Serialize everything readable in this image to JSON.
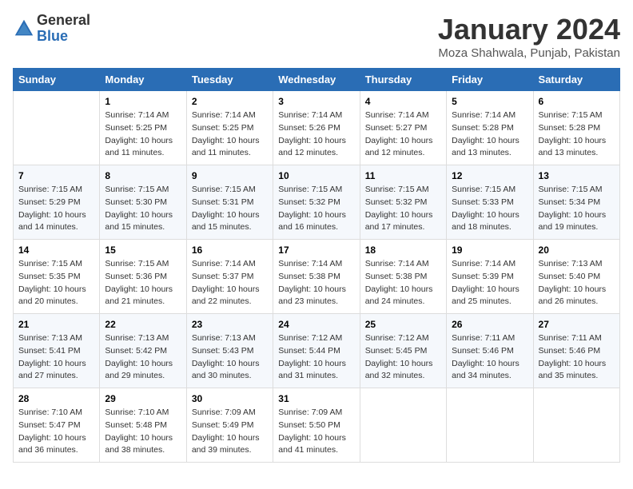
{
  "header": {
    "logo_general": "General",
    "logo_blue": "Blue",
    "month_title": "January 2024",
    "location": "Moza Shahwala, Punjab, Pakistan"
  },
  "days_of_week": [
    "Sunday",
    "Monday",
    "Tuesday",
    "Wednesday",
    "Thursday",
    "Friday",
    "Saturday"
  ],
  "weeks": [
    [
      {
        "day": "",
        "info": ""
      },
      {
        "day": "1",
        "info": "Sunrise: 7:14 AM\nSunset: 5:25 PM\nDaylight: 10 hours\nand 11 minutes."
      },
      {
        "day": "2",
        "info": "Sunrise: 7:14 AM\nSunset: 5:25 PM\nDaylight: 10 hours\nand 11 minutes."
      },
      {
        "day": "3",
        "info": "Sunrise: 7:14 AM\nSunset: 5:26 PM\nDaylight: 10 hours\nand 12 minutes."
      },
      {
        "day": "4",
        "info": "Sunrise: 7:14 AM\nSunset: 5:27 PM\nDaylight: 10 hours\nand 12 minutes."
      },
      {
        "day": "5",
        "info": "Sunrise: 7:14 AM\nSunset: 5:28 PM\nDaylight: 10 hours\nand 13 minutes."
      },
      {
        "day": "6",
        "info": "Sunrise: 7:15 AM\nSunset: 5:28 PM\nDaylight: 10 hours\nand 13 minutes."
      }
    ],
    [
      {
        "day": "7",
        "info": "Sunrise: 7:15 AM\nSunset: 5:29 PM\nDaylight: 10 hours\nand 14 minutes."
      },
      {
        "day": "8",
        "info": "Sunrise: 7:15 AM\nSunset: 5:30 PM\nDaylight: 10 hours\nand 15 minutes."
      },
      {
        "day": "9",
        "info": "Sunrise: 7:15 AM\nSunset: 5:31 PM\nDaylight: 10 hours\nand 15 minutes."
      },
      {
        "day": "10",
        "info": "Sunrise: 7:15 AM\nSunset: 5:32 PM\nDaylight: 10 hours\nand 16 minutes."
      },
      {
        "day": "11",
        "info": "Sunrise: 7:15 AM\nSunset: 5:32 PM\nDaylight: 10 hours\nand 17 minutes."
      },
      {
        "day": "12",
        "info": "Sunrise: 7:15 AM\nSunset: 5:33 PM\nDaylight: 10 hours\nand 18 minutes."
      },
      {
        "day": "13",
        "info": "Sunrise: 7:15 AM\nSunset: 5:34 PM\nDaylight: 10 hours\nand 19 minutes."
      }
    ],
    [
      {
        "day": "14",
        "info": "Sunrise: 7:15 AM\nSunset: 5:35 PM\nDaylight: 10 hours\nand 20 minutes."
      },
      {
        "day": "15",
        "info": "Sunrise: 7:15 AM\nSunset: 5:36 PM\nDaylight: 10 hours\nand 21 minutes."
      },
      {
        "day": "16",
        "info": "Sunrise: 7:14 AM\nSunset: 5:37 PM\nDaylight: 10 hours\nand 22 minutes."
      },
      {
        "day": "17",
        "info": "Sunrise: 7:14 AM\nSunset: 5:38 PM\nDaylight: 10 hours\nand 23 minutes."
      },
      {
        "day": "18",
        "info": "Sunrise: 7:14 AM\nSunset: 5:38 PM\nDaylight: 10 hours\nand 24 minutes."
      },
      {
        "day": "19",
        "info": "Sunrise: 7:14 AM\nSunset: 5:39 PM\nDaylight: 10 hours\nand 25 minutes."
      },
      {
        "day": "20",
        "info": "Sunrise: 7:13 AM\nSunset: 5:40 PM\nDaylight: 10 hours\nand 26 minutes."
      }
    ],
    [
      {
        "day": "21",
        "info": "Sunrise: 7:13 AM\nSunset: 5:41 PM\nDaylight: 10 hours\nand 27 minutes."
      },
      {
        "day": "22",
        "info": "Sunrise: 7:13 AM\nSunset: 5:42 PM\nDaylight: 10 hours\nand 29 minutes."
      },
      {
        "day": "23",
        "info": "Sunrise: 7:13 AM\nSunset: 5:43 PM\nDaylight: 10 hours\nand 30 minutes."
      },
      {
        "day": "24",
        "info": "Sunrise: 7:12 AM\nSunset: 5:44 PM\nDaylight: 10 hours\nand 31 minutes."
      },
      {
        "day": "25",
        "info": "Sunrise: 7:12 AM\nSunset: 5:45 PM\nDaylight: 10 hours\nand 32 minutes."
      },
      {
        "day": "26",
        "info": "Sunrise: 7:11 AM\nSunset: 5:46 PM\nDaylight: 10 hours\nand 34 minutes."
      },
      {
        "day": "27",
        "info": "Sunrise: 7:11 AM\nSunset: 5:46 PM\nDaylight: 10 hours\nand 35 minutes."
      }
    ],
    [
      {
        "day": "28",
        "info": "Sunrise: 7:10 AM\nSunset: 5:47 PM\nDaylight: 10 hours\nand 36 minutes."
      },
      {
        "day": "29",
        "info": "Sunrise: 7:10 AM\nSunset: 5:48 PM\nDaylight: 10 hours\nand 38 minutes."
      },
      {
        "day": "30",
        "info": "Sunrise: 7:09 AM\nSunset: 5:49 PM\nDaylight: 10 hours\nand 39 minutes."
      },
      {
        "day": "31",
        "info": "Sunrise: 7:09 AM\nSunset: 5:50 PM\nDaylight: 10 hours\nand 41 minutes."
      },
      {
        "day": "",
        "info": ""
      },
      {
        "day": "",
        "info": ""
      },
      {
        "day": "",
        "info": ""
      }
    ]
  ]
}
